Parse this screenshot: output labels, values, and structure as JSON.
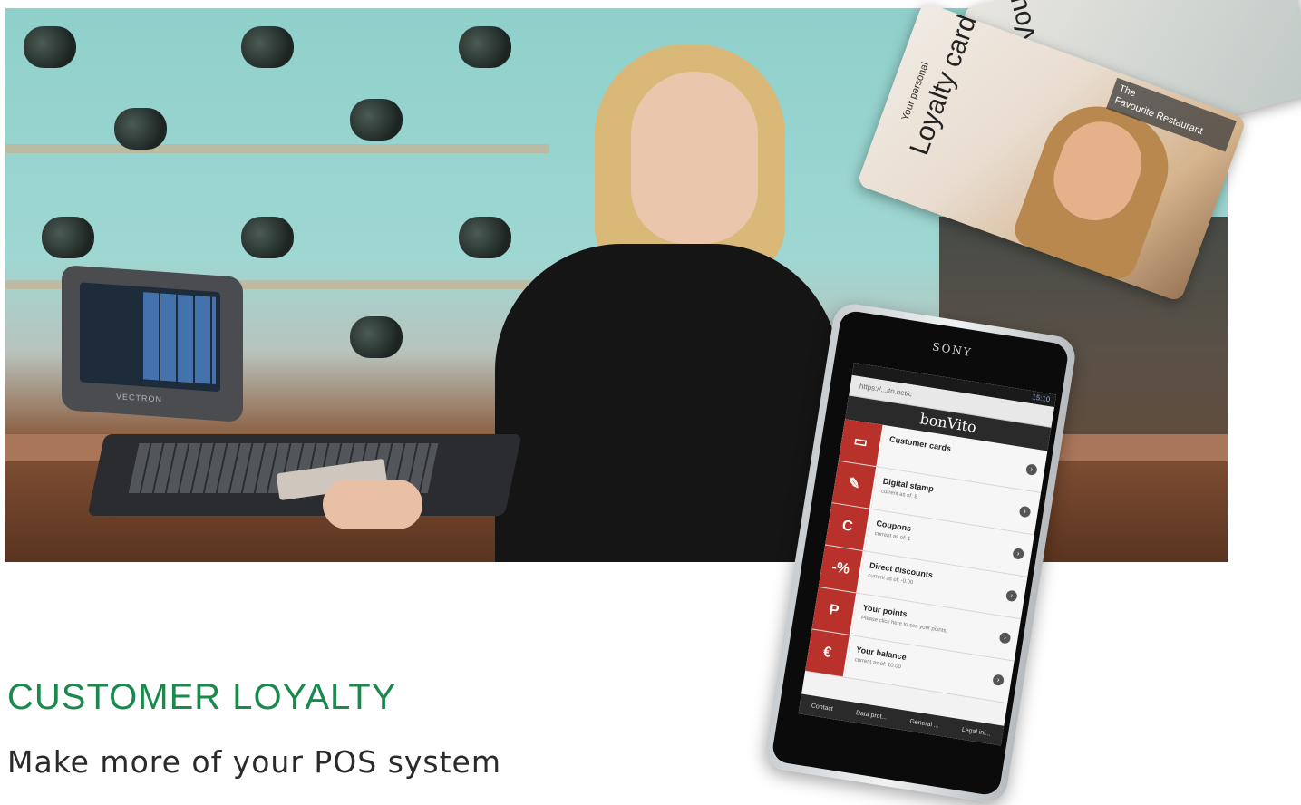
{
  "headline": "CUSTOMER LOYALTY",
  "subline": "Make more of your POS system",
  "colors": {
    "accent": "#1a8a4c",
    "app_red": "#b8322b"
  },
  "pos": {
    "brand": "VECTRON"
  },
  "cards": {
    "voucher_label": "Voucher Ca",
    "loyalty_small": "Your personal",
    "loyalty_big": "Loyalty card",
    "restaurant_tag_line1": "The",
    "restaurant_tag_line2": "Favourite Restaurant"
  },
  "phone": {
    "brand": "SONY",
    "status_time": "15:10",
    "url": "https://...ito.net/c",
    "app_title": "bonVito",
    "menu": [
      {
        "title": "Customer cards",
        "sub": "",
        "icon": "card-icon",
        "glyph": "▭"
      },
      {
        "title": "Digital stamp",
        "sub": "current as of: 8",
        "icon": "stamp-icon",
        "glyph": "✎"
      },
      {
        "title": "Coupons",
        "sub": "current as of: 1",
        "icon": "coupon-icon",
        "glyph": "C"
      },
      {
        "title": "Direct discounts",
        "sub": "current as of: -0.00",
        "icon": "discount-icon",
        "glyph": "-%"
      },
      {
        "title": "Your points",
        "sub": "Please click here to see your points.",
        "icon": "points-icon",
        "glyph": "P"
      },
      {
        "title": "Your balance",
        "sub": "current as of: 10.00",
        "icon": "balance-icon",
        "glyph": "€"
      }
    ],
    "footer": [
      "Contact",
      "Data prot...",
      "General ...",
      "Legal inf..."
    ]
  }
}
